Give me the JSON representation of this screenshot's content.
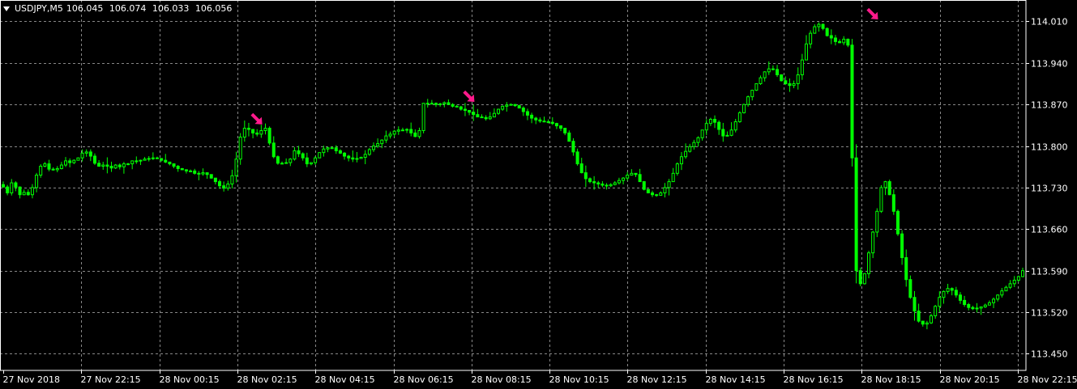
{
  "header": {
    "symbol": "USDJPY,M5",
    "open": "106.045",
    "high": "106.074",
    "low": "106.033",
    "close": "106.056"
  },
  "colors": {
    "background": "#000000",
    "grid": "#c0c0c0",
    "candle": "#00ff00",
    "axis_text": "#ffffff",
    "arrow": "#ff1a8c"
  },
  "chart_data": {
    "type": "candlestick",
    "grid": true,
    "y_ticks": [
      "114.010",
      "113.940",
      "113.870",
      "113.800",
      "113.730",
      "113.660",
      "113.590",
      "113.520",
      "113.450"
    ],
    "ylim": [
      113.422,
      114.046
    ],
    "x_ticks": [
      "27 Nov 2018",
      "27 Nov 22:15",
      "28 Nov 00:15",
      "28 Nov 02:15",
      "28 Nov 04:15",
      "28 Nov 06:15",
      "28 Nov 08:15",
      "28 Nov 10:15",
      "28 Nov 12:15",
      "28 Nov 14:15",
      "28 Nov 16:15",
      "28 Nov 18:15",
      "28 Nov 20:15",
      "28 Nov 22:15"
    ],
    "series": [
      {
        "name": "USDJPY,M5",
        "close": [
          113.731,
          113.721,
          113.738,
          113.731,
          113.718,
          113.722,
          113.718,
          113.73,
          113.751,
          113.766,
          113.77,
          113.761,
          113.76,
          113.762,
          113.768,
          113.775,
          113.772,
          113.776,
          113.78,
          113.788,
          113.79,
          113.783,
          113.771,
          113.766,
          113.768,
          113.766,
          113.763,
          113.768,
          113.765,
          113.77,
          113.77,
          113.775,
          113.775,
          113.776,
          113.778,
          113.779,
          113.78,
          113.779,
          113.776,
          113.773,
          113.77,
          113.766,
          113.762,
          113.76,
          113.758,
          113.758,
          113.754,
          113.753,
          113.755,
          113.752,
          113.746,
          113.74,
          113.733,
          113.729,
          113.736,
          113.75,
          113.778,
          113.815,
          113.83,
          113.828,
          113.822,
          113.82,
          113.826,
          113.83,
          113.805,
          113.782,
          113.771,
          113.771,
          113.772,
          113.778,
          113.792,
          113.787,
          113.78,
          113.77,
          113.772,
          113.78,
          113.789,
          113.795,
          113.797,
          113.797,
          113.792,
          113.788,
          113.783,
          113.78,
          113.778,
          113.779,
          113.781,
          113.786,
          113.794,
          113.8,
          113.804,
          113.81,
          113.817,
          113.82,
          113.825,
          113.827,
          113.827,
          113.828,
          113.822,
          113.816,
          113.826,
          113.872,
          113.871,
          113.872,
          113.87,
          113.871,
          113.873,
          113.87,
          113.867,
          113.866,
          113.862,
          113.86,
          113.857,
          113.853,
          113.849,
          113.848,
          113.846,
          113.849,
          113.855,
          113.862,
          113.867,
          113.869,
          113.87,
          113.868,
          113.864,
          113.858,
          113.852,
          113.847,
          113.844,
          113.842,
          113.841,
          113.84,
          113.838,
          113.834,
          113.83,
          113.822,
          113.808,
          113.79,
          113.77,
          113.755,
          113.745,
          113.74,
          113.738,
          113.736,
          113.734,
          113.733,
          113.735,
          113.738,
          113.742,
          113.746,
          113.751,
          113.754,
          113.752,
          113.74,
          113.727,
          113.721,
          113.718,
          113.717,
          113.721,
          113.73,
          113.74,
          113.754,
          113.77,
          113.782,
          113.791,
          113.799,
          113.806,
          113.814,
          113.827,
          113.838,
          113.845,
          113.84,
          113.828,
          113.817,
          113.818,
          113.827,
          113.841,
          113.856,
          113.87,
          113.883,
          113.894,
          113.905,
          113.915,
          113.925,
          113.93,
          113.929,
          113.92,
          113.91,
          113.905,
          113.902,
          113.905,
          113.92,
          113.945,
          113.972,
          113.99,
          114.001,
          114.005,
          113.998,
          113.986,
          113.982,
          113.976,
          113.974,
          113.98,
          113.97,
          113.78,
          113.59,
          113.568,
          113.585,
          113.62,
          113.655,
          113.69,
          113.73,
          113.74,
          113.718,
          113.69,
          113.652,
          113.612,
          113.575,
          113.545,
          113.522,
          113.505,
          113.5,
          113.502,
          113.514,
          113.53,
          113.545,
          113.555,
          113.56,
          113.557,
          113.549,
          113.54,
          113.533,
          113.528,
          113.526,
          113.527,
          113.529,
          113.532,
          113.536,
          113.542,
          113.549,
          113.556,
          113.562,
          113.568,
          113.574,
          113.58,
          113.59
        ]
      }
    ],
    "arrows": [
      {
        "index": 61,
        "price": 113.845
      },
      {
        "index": 112,
        "price": 113.883
      },
      {
        "index": 209,
        "price": 114.022
      }
    ]
  }
}
